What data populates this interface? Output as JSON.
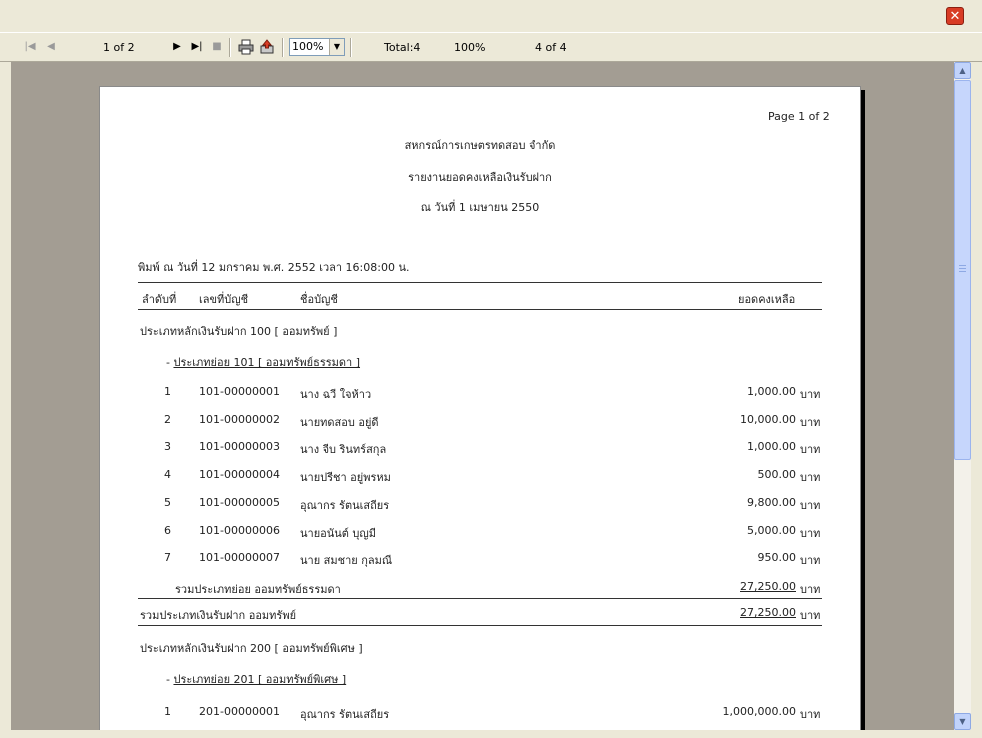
{
  "toolbar": {
    "page_indicator": "1 of 2",
    "zoom_value": "100%",
    "total": "Total:4",
    "percent": "100%",
    "records": "4 of 4"
  },
  "report": {
    "page_number": "Page 1 of 2",
    "company": "สหกรณ์การเกษตรทดสอบ จำกัด",
    "title": "รายงานยอดคงเหลือเงินรับฝาก",
    "as_of": "ณ วันที่ 1 เมษายน 2550",
    "printed": "พิมพ์ ณ วันที่ 12 มกราคม พ.ศ. 2552 เวลา 16:08:00 น.",
    "columns": {
      "seq": "ลำดับที่",
      "account_no": "เลขที่บัญชี",
      "account_name": "ชื่อบัญชี",
      "balance": "ยอดคงเหลือ"
    },
    "currency": "บาท",
    "group1": {
      "header": "ประเภทหลักเงินรับฝาก 100 [ ออมทรัพย์ ]",
      "subheader_prefix": "- ",
      "subheader": "ประเภทย่อย 101 [ ออมทรัพย์ธรรมดา ]",
      "rows": [
        {
          "seq": "1",
          "account_no": "101-00000001",
          "name": "นาง ฉวี ใจห้าว",
          "balance": "1,000.00"
        },
        {
          "seq": "2",
          "account_no": "101-00000002",
          "name": "นายทดสอบ อยู่ดี",
          "balance": "10,000.00"
        },
        {
          "seq": "3",
          "account_no": "101-00000003",
          "name": "นาง จีบ รินทร์สกุล",
          "balance": "1,000.00"
        },
        {
          "seq": "4",
          "account_no": "101-00000004",
          "name": "นายปรีชา อยู่พรหม",
          "balance": "500.00"
        },
        {
          "seq": "5",
          "account_no": "101-00000005",
          "name": "อุณากร รัตนเสถียร",
          "balance": "9,800.00"
        },
        {
          "seq": "6",
          "account_no": "101-00000006",
          "name": "นายอนันต์ บุญมี",
          "balance": "5,000.00"
        },
        {
          "seq": "7",
          "account_no": "101-00000007",
          "name": "นาย สมชาย กุลมณี",
          "balance": "950.00"
        }
      ],
      "sub_total_label": "รวมประเภทย่อย ออมทรัพย์ธรรมดา",
      "sub_total": "27,250.00",
      "group_total_label": "รวมประเภทเงินรับฝาก ออมทรัพย์",
      "group_total": "27,250.00"
    },
    "group2": {
      "header": "ประเภทหลักเงินรับฝาก 200 [ ออมทรัพย์พิเศษ ]",
      "subheader_prefix": "- ",
      "subheader": "ประเภทย่อย 201 [ ออมทรัพย์พิเศษ ]",
      "rows": [
        {
          "seq": "1",
          "account_no": "201-00000001",
          "name": "อุณากร รัตนเสถียร",
          "balance": "1,000,000.00"
        }
      ]
    }
  }
}
